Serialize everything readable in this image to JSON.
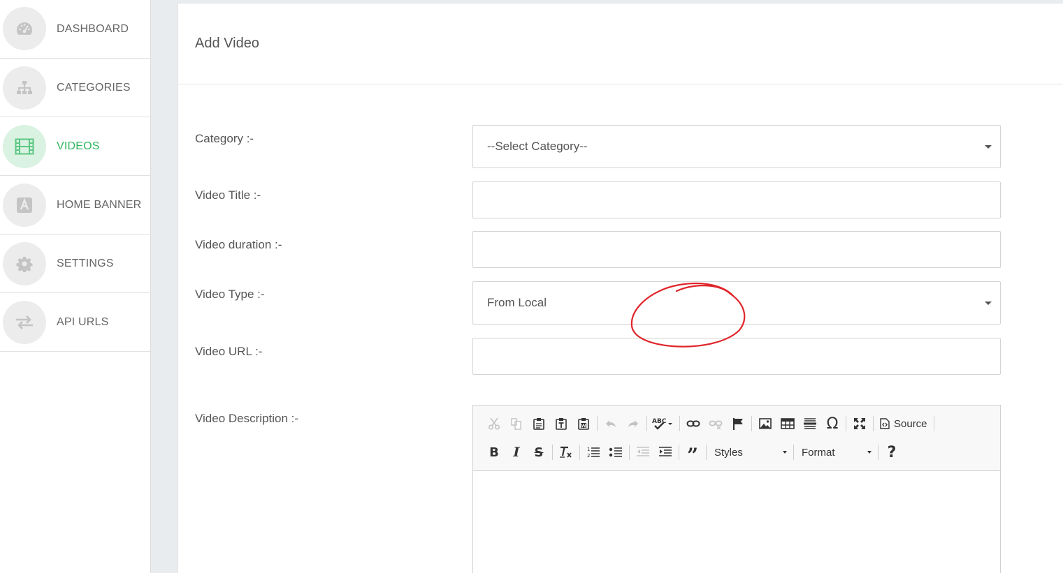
{
  "sidebar": {
    "items": [
      {
        "label": "DASHBOARD",
        "icon": "dashboard-gauge-icon",
        "active": false
      },
      {
        "label": "CATEGORIES",
        "icon": "sitemap-icon",
        "active": false
      },
      {
        "label": "VIDEOS",
        "icon": "film-icon",
        "active": true
      },
      {
        "label": "HOME BANNER",
        "icon": "font-a-icon",
        "active": false
      },
      {
        "label": "SETTINGS",
        "icon": "gear-icon",
        "active": false
      },
      {
        "label": "API URLS",
        "icon": "exchange-arrows-icon",
        "active": false
      }
    ]
  },
  "page": {
    "title": "Add Video"
  },
  "form": {
    "category": {
      "label": "Category :-",
      "value": "--Select Category--"
    },
    "title": {
      "label": "Video Title :-",
      "value": ""
    },
    "duration": {
      "label": "Video duration :-",
      "value": ""
    },
    "type": {
      "label": "Video Type :-",
      "value": "From Local"
    },
    "url": {
      "label": "Video URL :-",
      "value": ""
    },
    "description": {
      "label": "Video Description :-",
      "value": ""
    }
  },
  "editor": {
    "source_label": "Source",
    "styles_label": "Styles",
    "format_label": "Format"
  },
  "colors": {
    "active": "#2fb75c",
    "annotation": "#e0252a"
  }
}
